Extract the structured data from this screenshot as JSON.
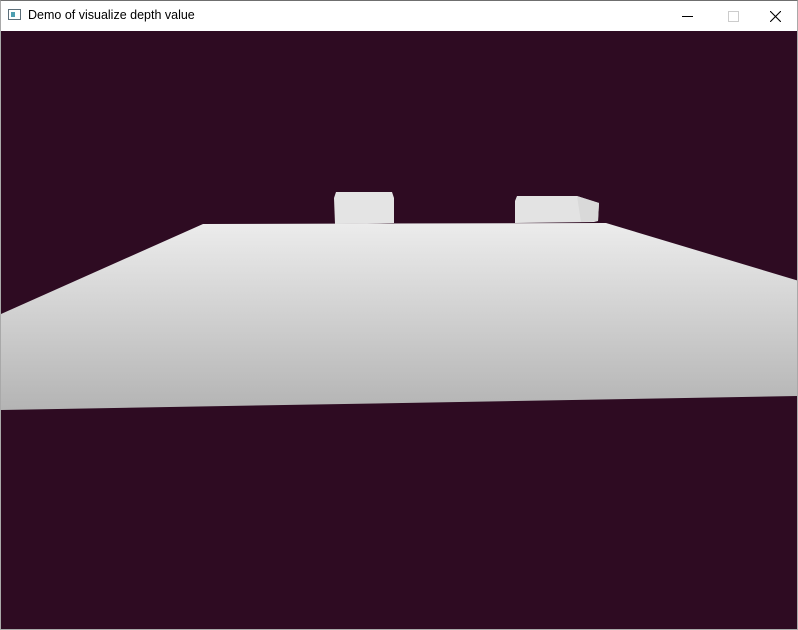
{
  "window": {
    "title": "Demo of visualize depth value",
    "icon": "app-window-icon",
    "controls": {
      "minimize_icon": "minimize-icon",
      "maximize_icon": "maximize-icon",
      "maximize_enabled": false,
      "close_icon": "close-icon"
    }
  },
  "scene": {
    "background_color": "#2e0b22",
    "objects": [
      "ground-plane",
      "cube",
      "cube"
    ],
    "near_color": "#b4b4b4",
    "far_color": "#ececec"
  }
}
